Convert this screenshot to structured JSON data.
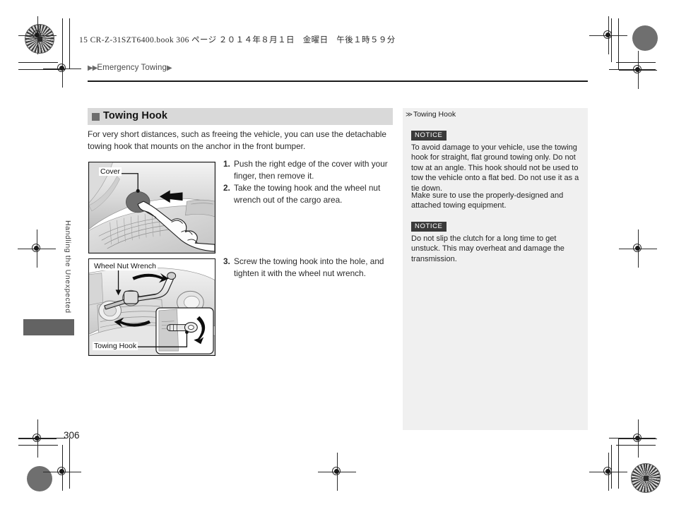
{
  "book_info": "15 CR-Z-31SZT6400.book  306 ページ  ２０１４年８月１日　金曜日　午後１時５９分",
  "breadcrumb": {
    "leading_arrows": "▶▶",
    "label": "Emergency Towing",
    "trailing_arrow": "▶"
  },
  "chapter_tab": {
    "label": "Handling the Unexpected"
  },
  "section": {
    "title": "Towing Hook",
    "bullet": "square-bullet"
  },
  "intro": "For very short distances, such as freeing the vehicle, you can use the detachable towing hook that mounts on the anchor in the front bumper.",
  "figures": [
    {
      "id": "fig-cover",
      "labels": [
        "Cover"
      ],
      "description": "front bumper cover being pushed with a finger"
    },
    {
      "id": "fig-hook",
      "labels": [
        "Wheel Nut Wrench",
        "Towing Hook"
      ],
      "description": "towing hook screwed into the anchor and tightened with the wheel nut wrench"
    }
  ],
  "steps_top": [
    {
      "num": "1.",
      "text": "Push the right edge of the cover with your finger, then remove it."
    },
    {
      "num": "2.",
      "text": "Take the towing hook and the wheel nut wrench out of the cargo area."
    }
  ],
  "steps_bottom": [
    {
      "num": "3.",
      "text": "Screw the towing hook into the hole, and tighten it with the wheel nut wrench."
    }
  ],
  "side_panel": {
    "head_icon": "≫",
    "head_label": "Towing Hook",
    "notes": [
      {
        "tag": "NOTICE",
        "text": "To avoid damage to your vehicle, use the towing hook for straight, flat ground towing only. Do not tow at an angle. This hook should not be used to tow the vehicle onto a flat bed. Do not use it as a tie down."
      },
      {
        "tag": "",
        "text": "Make sure to use the properly-designed and attached towing equipment."
      },
      {
        "tag": "NOTICE",
        "text": "Do not slip the clutch for a long time to get unstuck. This may overheat and damage the transmission."
      }
    ]
  },
  "folio": "306",
  "colors": {
    "section_bar": "#d9d9d9",
    "side_panel": "#f0f0f0",
    "notice_tag": "#3a3a3a",
    "tab_block": "#636363"
  }
}
